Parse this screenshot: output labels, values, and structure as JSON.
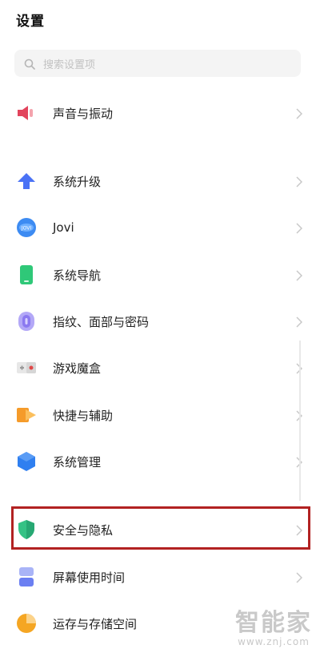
{
  "header": {
    "title": "设置"
  },
  "search": {
    "placeholder": "搜索设置项"
  },
  "items": [
    {
      "label": "声音与振动",
      "icon": "speaker-icon",
      "color": "#e2445c"
    },
    {
      "label": "系统升级",
      "icon": "arrow-up-icon",
      "color": "#4a72f5"
    },
    {
      "label": "Jovi",
      "icon": "jovi-icon",
      "color": "#3d8bf2"
    },
    {
      "label": "系统导航",
      "icon": "phone-icon",
      "color": "#2fc878"
    },
    {
      "label": "指纹、面部与密码",
      "icon": "fingerprint-icon",
      "color": "#8b79f0"
    },
    {
      "label": "游戏魔盒",
      "icon": "game-box-icon",
      "color": "#e04848"
    },
    {
      "label": "快捷与辅助",
      "icon": "shortcut-icon",
      "color": "#f59b2a"
    },
    {
      "label": "系统管理",
      "icon": "system-management-icon",
      "color": "#2f7ff0"
    },
    {
      "label": "安全与隐私",
      "icon": "shield-icon",
      "color": "#35c285"
    },
    {
      "label": "屏幕使用时间",
      "icon": "hourglass-icon",
      "color": "#6b7ff2"
    },
    {
      "label": "运存与存储空间",
      "icon": "storage-pie-icon",
      "color": "#f5a623"
    }
  ],
  "highlight": {
    "color": "#b22222"
  },
  "watermark": {
    "main": "智能家",
    "url": "www.znj.com"
  }
}
